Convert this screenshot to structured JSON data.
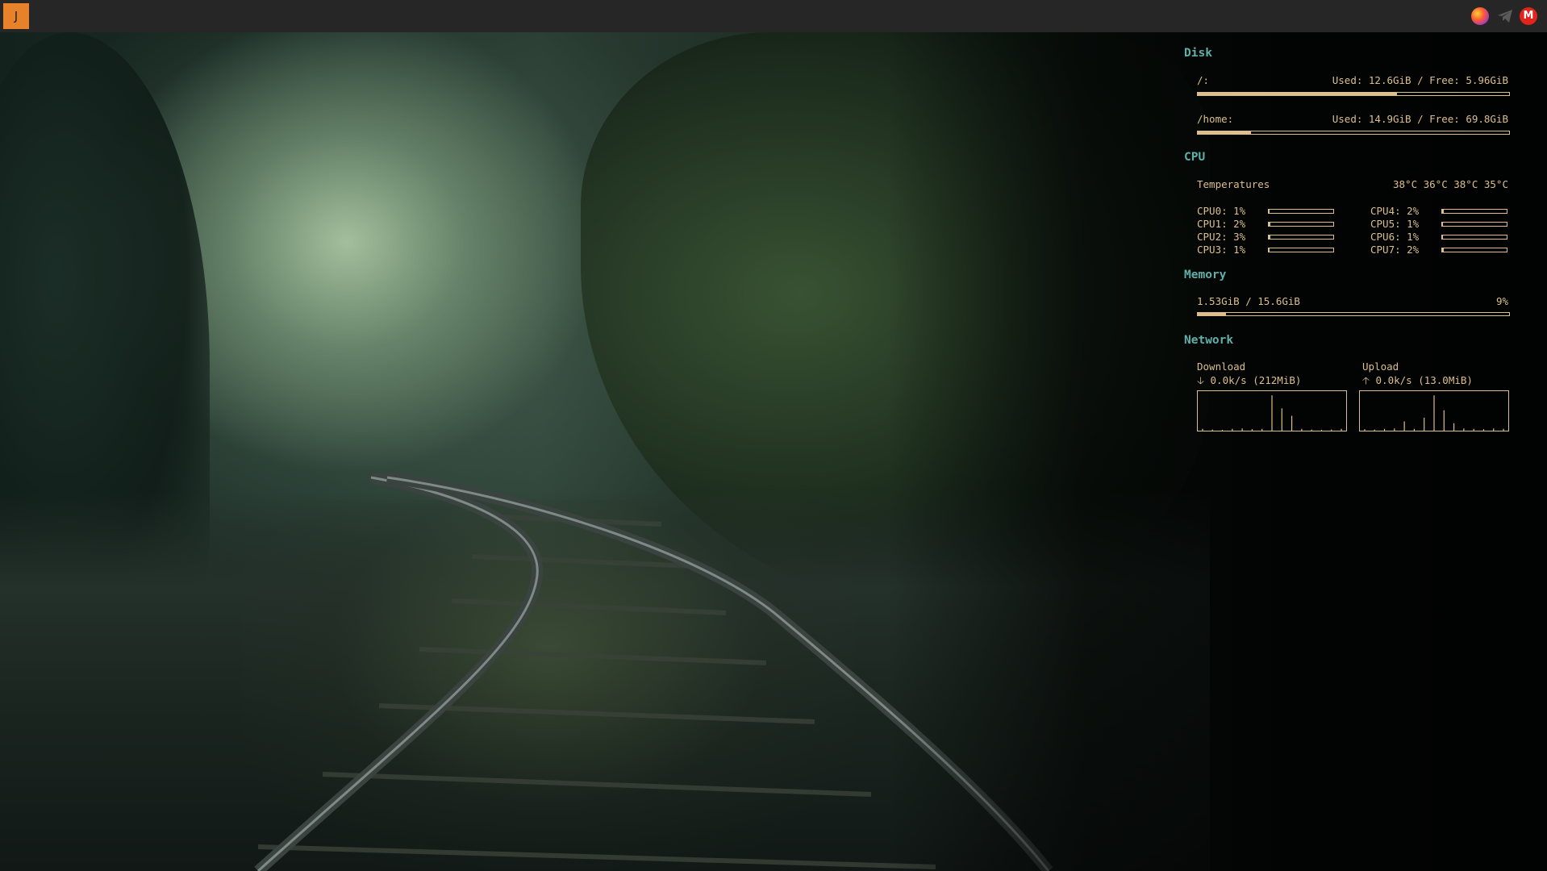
{
  "taskbar": {
    "launcher_label": "J",
    "tray": [
      {
        "name": "firefox-icon"
      },
      {
        "name": "telegram-icon"
      },
      {
        "name": "gmail-icon",
        "glyph": "M"
      }
    ]
  },
  "colors": {
    "accent_text": "#dcbf8c",
    "section_title": "#5fb0aa",
    "launcher": "#e8822a",
    "panel": "#262626"
  },
  "conky": {
    "disk": {
      "title": "Disk",
      "mounts": [
        {
          "label": "/:",
          "usage": "Used: 12.6GiB / Free: 5.96GiB",
          "fraction": 0.64
        },
        {
          "label": "/home:",
          "usage": "Used: 14.9GiB / Free: 69.8GiB",
          "fraction": 0.17
        }
      ]
    },
    "cpu": {
      "title": "CPU",
      "temps_label": "Temperatures",
      "temps": "38°C 36°C 38°C 35°C",
      "cores": [
        {
          "label": "CPU0: 1%",
          "percent": 1
        },
        {
          "label": "CPU1: 2%",
          "percent": 2
        },
        {
          "label": "CPU2: 3%",
          "percent": 3
        },
        {
          "label": "CPU3: 1%",
          "percent": 1
        },
        {
          "label": "CPU4: 2%",
          "percent": 2
        },
        {
          "label": "CPU5: 1%",
          "percent": 1
        },
        {
          "label": "CPU6: 1%",
          "percent": 1
        },
        {
          "label": "CPU7: 2%",
          "percent": 2
        }
      ]
    },
    "memory": {
      "title": "Memory",
      "usage": "1.53GiB / 15.6GiB",
      "percent_label": "9%",
      "fraction": 0.09
    },
    "network": {
      "title": "Network",
      "download": {
        "label": "Download",
        "arrow": "🡣",
        "rate": "0.0k/s (212MiB)",
        "spikes": [
          0.05,
          0.03,
          0.02,
          0.05,
          0.06,
          0.04,
          0.05,
          0.95,
          0.6,
          0.4,
          0.05,
          0.03,
          0.02,
          0.03,
          0.05
        ]
      },
      "upload": {
        "label": "Upload",
        "arrow": "🡡",
        "rate": "0.0k/s (13.0MiB)",
        "spikes": [
          0.04,
          0.03,
          0.05,
          0.06,
          0.25,
          0.05,
          0.35,
          0.95,
          0.55,
          0.2,
          0.06,
          0.05,
          0.04,
          0.06,
          0.05
        ]
      }
    }
  }
}
